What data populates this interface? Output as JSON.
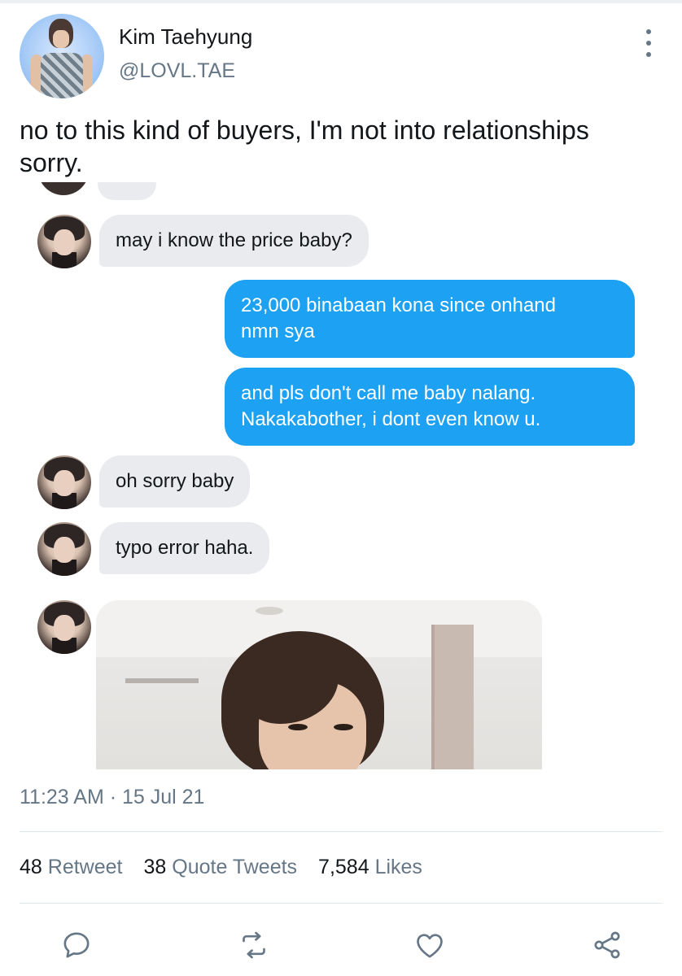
{
  "author": {
    "display_name": "Kim Taehyung",
    "handle": "@LOVL.TAE"
  },
  "tweet": {
    "text": "no to this kind of buyers, I'm not into relationships sorry."
  },
  "conversation": [
    {
      "from": "them",
      "text": "may i know the price baby?"
    },
    {
      "from": "me",
      "text": "23,000 binabaan kona since onhand\nnmn sya"
    },
    {
      "from": "me",
      "text": "and pls don't call me baby nalang.\nNakakabother, i dont even know u."
    },
    {
      "from": "them",
      "text": "oh sorry baby"
    },
    {
      "from": "them",
      "text": "typo error haha."
    }
  ],
  "meta": {
    "timestamp": "11:23 AM · 15 Jul 21"
  },
  "stats": {
    "retweets_count": "48",
    "retweets_label": "Retweet",
    "quotes_count": "38",
    "quotes_label": "Quote Tweets",
    "likes_count": "7,584",
    "likes_label": "Likes"
  },
  "colors": {
    "accent": "#1da1f2",
    "secondary_text": "#657786",
    "incoming_bubble": "#e9ebee"
  },
  "icons": {
    "more": "more-vertical-icon",
    "reply": "reply-icon",
    "retweet": "retweet-icon",
    "like": "heart-icon",
    "share": "share-icon"
  }
}
